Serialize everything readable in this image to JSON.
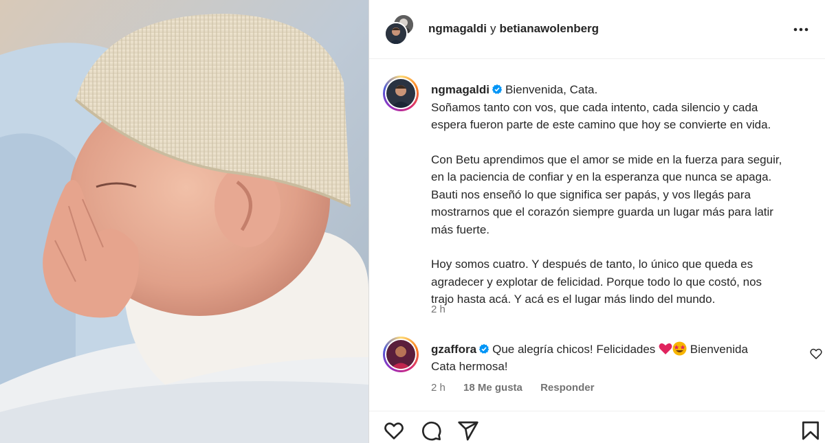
{
  "post": {
    "header": {
      "user1": "ngmagaldi",
      "conjunction": "y",
      "user2": "betianawolenberg",
      "more_icon": "more-horizontal-icon"
    },
    "caption": {
      "username": "ngmagaldi",
      "verified_icon": "verified-badge-icon",
      "lines_p1": [
        "Bienvenida, Cata.",
        "Soñamos tanto con vos, que cada intento, cada silencio y cada",
        "espera fueron parte de este camino que hoy se convierte en vida."
      ],
      "lines_p2": [
        "Con Betu aprendimos que el amor se mide en la fuerza para seguir,",
        "en la paciencia de confiar y en la esperanza que nunca se apaga.",
        "Bauti nos enseñó lo que significa ser papás, y vos llegás para",
        "mostrarnos que el corazón siempre guarda un lugar más para latir",
        "más fuerte."
      ],
      "lines_p3": [
        "Hoy somos cuatro. Y después de tanto, lo único que queda es",
        "agradecer y explotar de felicidad. Porque todo lo que costó, nos",
        "trajo hasta acá. Y acá es el lugar más lindo del mundo."
      ],
      "time": "2 h"
    },
    "comment": {
      "username": "gzaffora",
      "text_a": "Que alegría chicos! Felicidades",
      "text_b": "Bienvenida",
      "text_c": "Cata hermosa!",
      "emojis": [
        "red-heart-emoji",
        "star-struck-emoji"
      ],
      "time": "2 h",
      "likes": "18 Me gusta",
      "reply": "Responder",
      "like_icon": "heart-outline-icon"
    },
    "actions": {
      "like_icon": "heart-outline-icon",
      "comment_icon": "speech-bubble-icon",
      "share_icon": "paper-plane-icon",
      "save_icon": "bookmark-icon"
    },
    "colors": {
      "text": "#262626",
      "secondary": "#737373",
      "verified": "#0095f6",
      "heart": "#e0245e"
    }
  }
}
